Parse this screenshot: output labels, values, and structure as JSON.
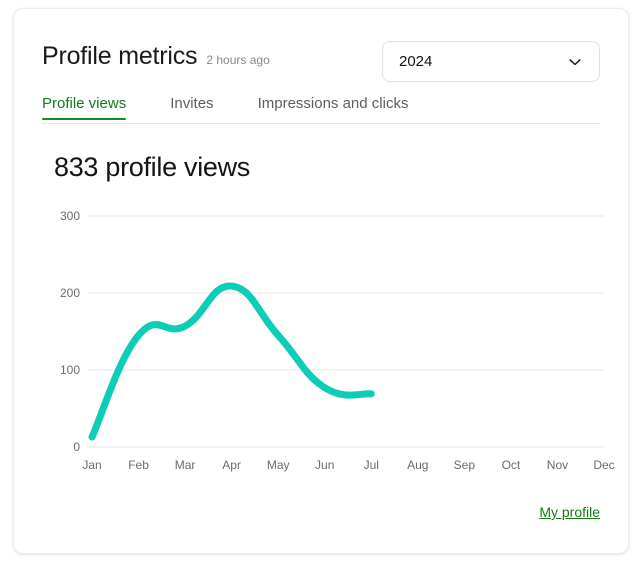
{
  "header": {
    "title": "Profile metrics",
    "timestamp": "2 hours ago",
    "year_selected": "2024",
    "chevron_icon": "chevron-down-icon"
  },
  "tabs": [
    {
      "label": "Profile views",
      "active": true
    },
    {
      "label": "Invites",
      "active": false
    },
    {
      "label": "Impressions and clicks",
      "active": false
    }
  ],
  "metric": {
    "value": 833,
    "label": "833 profile views"
  },
  "footer": {
    "profile_link": "My profile"
  },
  "colors": {
    "accent_green": "#188a1b",
    "line_teal": "#0ccdb5",
    "grid": "#e6e6e6",
    "axis_text": "#6b6b6b"
  },
  "chart_data": {
    "type": "line",
    "title": "",
    "xlabel": "",
    "ylabel": "",
    "categories": [
      "Jan",
      "Feb",
      "Mar",
      "Apr",
      "May",
      "Jun",
      "Jul",
      "Aug",
      "Sep",
      "Oct",
      "Nov",
      "Dec"
    ],
    "series": [
      {
        "name": "Profile views",
        "color": "#0ccdb5",
        "values": [
          13,
          145,
          157,
          209,
          145,
          77,
          69,
          null,
          null,
          null,
          null,
          null
        ]
      }
    ],
    "yticks": [
      0,
      100,
      200,
      300
    ],
    "ylim": [
      0,
      300
    ],
    "grid": true,
    "legend": "none",
    "smoothing": "monotone-spline"
  }
}
